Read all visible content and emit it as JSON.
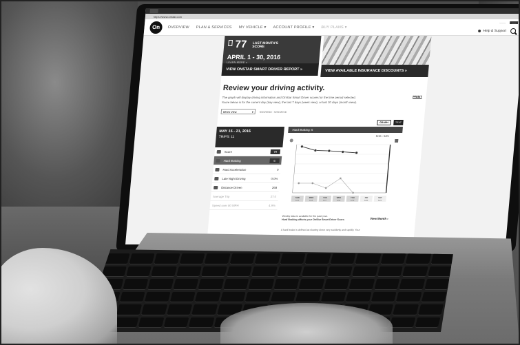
{
  "browser": {
    "url": "https://www.onstar.com"
  },
  "nav": {
    "logo_text": "On",
    "items": [
      {
        "label": "OVERVIEW"
      },
      {
        "label": "PLAN & SERVICES"
      },
      {
        "label": "MY VEHICLE ▾"
      },
      {
        "label": "ACCOUNT PROFILE ▾"
      },
      {
        "label": "BUY PLANS ▾"
      }
    ],
    "help_label": "Help & Support"
  },
  "score_card": {
    "score": "77",
    "score_label": "LAST MONTH'S SCORE",
    "date_range": "APRIL 1 - 30, 2016",
    "learn_more": "LEARN MORE »",
    "report_link": "VIEW ONSTAR SMART DRIVER REPORT »"
  },
  "insurance": {
    "link": "VIEW AVAILABLE INSURANCE DISCOUNTS »"
  },
  "review": {
    "title": "Review your driving activity.",
    "print": "PRINT",
    "desc_1": "The graph will display driving information and OnStar Smart Driver scores for the time period selected.",
    "desc_2": "Score below is for the current day (day view), the last 7 days (week view), or last 30 days (month view).",
    "view_select": "Week View",
    "dates": "5/15/2016 - 5/21/2016",
    "graph_btn": "GRAPH",
    "text_btn": "TEXT"
  },
  "week_panel": {
    "range": "MAY 15 - 21, 2016",
    "trips": "TRIPS: 11"
  },
  "metrics": [
    {
      "label": "Score",
      "value": "79"
    },
    {
      "label": "Hard Braking",
      "value": "6"
    },
    {
      "label": "Hard Acceleration",
      "value": "0"
    },
    {
      "label": "Late Night Driving",
      "value": "0.0%"
    },
    {
      "label": "Distance Driven",
      "value": "268"
    },
    {
      "label": "Average Trip",
      "value": "27.0"
    },
    {
      "label": "Speed over 80 MPH",
      "value": "4.9%"
    }
  ],
  "chart_panel": {
    "header": "Hard Braking: 6",
    "range": "5/15 - 5/21",
    "days": [
      "SUN",
      "MON",
      "TUE",
      "WED",
      "THU",
      "FRI",
      "SAT"
    ],
    "day_dates": [
      "5/15",
      "5/16",
      "5/17",
      "5/18",
      "5/19",
      "5/20",
      "5/21"
    ],
    "weekly_note": "Weekly data is available for the past year.",
    "weekly_note_bold": "Hard Braking affects your OnStar Smart Driver Score.",
    "view_month": "View Month ›",
    "hb_note": "A hard brake is defined as slowing down very suddenly and rapidly. Your"
  },
  "chart_data": {
    "type": "line",
    "categories": [
      "SUN",
      "MON",
      "TUE",
      "WED",
      "THU",
      "FRI",
      "SAT"
    ],
    "series": [
      {
        "values": [
          96,
          88,
          87,
          85,
          83,
          null,
          null
        ]
      },
      {
        "values": [
          2,
          2,
          1,
          3,
          0,
          null,
          null
        ]
      }
    ],
    "ylim_score": [
      0,
      100
    ],
    "ylim_events": [
      0,
      10
    ]
  }
}
